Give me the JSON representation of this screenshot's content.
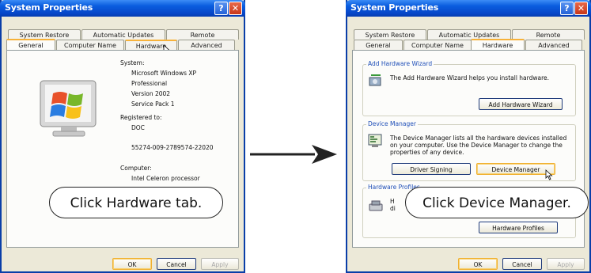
{
  "left_window": {
    "title": "System Properties",
    "help_glyph": "?",
    "close_glyph": "✕",
    "tabs_row1": [
      "System Restore",
      "Automatic Updates",
      "Remote"
    ],
    "tabs_row2": [
      "General",
      "Computer Name",
      "Hardware",
      "Advanced"
    ],
    "active_tab": "General",
    "system_label": "System:",
    "os_name": "Microsoft Windows XP",
    "edition": "Professional",
    "version": "Version 2002",
    "service_pack": "Service Pack 1",
    "registered_label": "Registered to:",
    "registered_name": "DOC",
    "product_id": "55274-009-2789574-22020",
    "computer_label": "Computer:",
    "processor": "Intel Celeron processor",
    "ok": "OK",
    "cancel": "Cancel",
    "apply": "Apply"
  },
  "right_window": {
    "title": "System Properties",
    "help_glyph": "?",
    "close_glyph": "✕",
    "tabs_row1": [
      "System Restore",
      "Automatic Updates",
      "Remote"
    ],
    "tabs_row2": [
      "General",
      "Computer Name",
      "Hardware",
      "Advanced"
    ],
    "active_tab": "Hardware",
    "add_hw_group": "Add Hardware Wizard",
    "add_hw_text": "The Add Hardware Wizard helps you install hardware.",
    "add_hw_button": "Add Hardware Wizard",
    "dm_group": "Device Manager",
    "dm_text_1": "The Device Manager lists all the hardware devices installed",
    "dm_text_2": "on your computer. Use the Device Manager to change the",
    "dm_text_3": "properties of any device.",
    "driver_signing": "Driver Signing",
    "device_manager_button": "Device Manager",
    "hp_group": "Hardware Profiles",
    "hp_text_1": "H",
    "hp_text_2": "di",
    "hp_button": "Hardware Profiles",
    "ok": "OK",
    "cancel": "Cancel",
    "apply": "Apply"
  },
  "callouts": {
    "left": "Click Hardware tab.",
    "right": "Click Device Manager."
  },
  "colors": {
    "title_bar": "#0a5ddf",
    "dialog_bg": "#ece9d8",
    "tab_highlight": "#f7b23a",
    "arrow": "#222222"
  }
}
